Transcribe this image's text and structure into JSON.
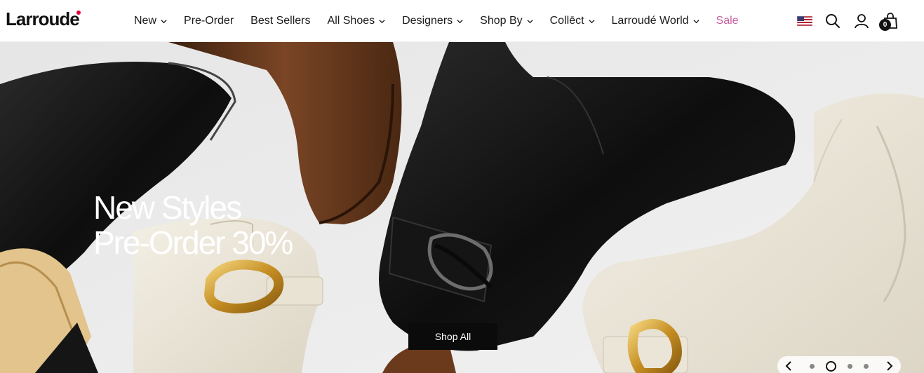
{
  "brand": {
    "name": "Larroude",
    "accent_color": "#e0003c"
  },
  "nav": {
    "items": [
      {
        "label": "New",
        "has_dropdown": true
      },
      {
        "label": "Pre-Order",
        "has_dropdown": false
      },
      {
        "label": "Best Sellers",
        "has_dropdown": false
      },
      {
        "label": "All Shoes",
        "has_dropdown": true
      },
      {
        "label": "Designers",
        "has_dropdown": true
      },
      {
        "label": "Shop By",
        "has_dropdown": true
      },
      {
        "label": "Collect",
        "has_dropdown": true
      },
      {
        "label": "Larroudé World",
        "has_dropdown": true
      },
      {
        "label": "Sale",
        "has_dropdown": false
      }
    ],
    "sale_color": "#c85fa0",
    "collect_display": "Collēct"
  },
  "utility": {
    "flag_icon": "us-flag-icon",
    "search_icon": "search-icon",
    "account_icon": "account-icon",
    "cart_icon": "shopping-bag-icon",
    "cart_count": "0"
  },
  "hero": {
    "headline_line1": "New Styles",
    "headline_line2": "Pre-Order 30%",
    "cta_label": "Shop All",
    "slides": {
      "count": 4,
      "active_index": 1
    }
  }
}
